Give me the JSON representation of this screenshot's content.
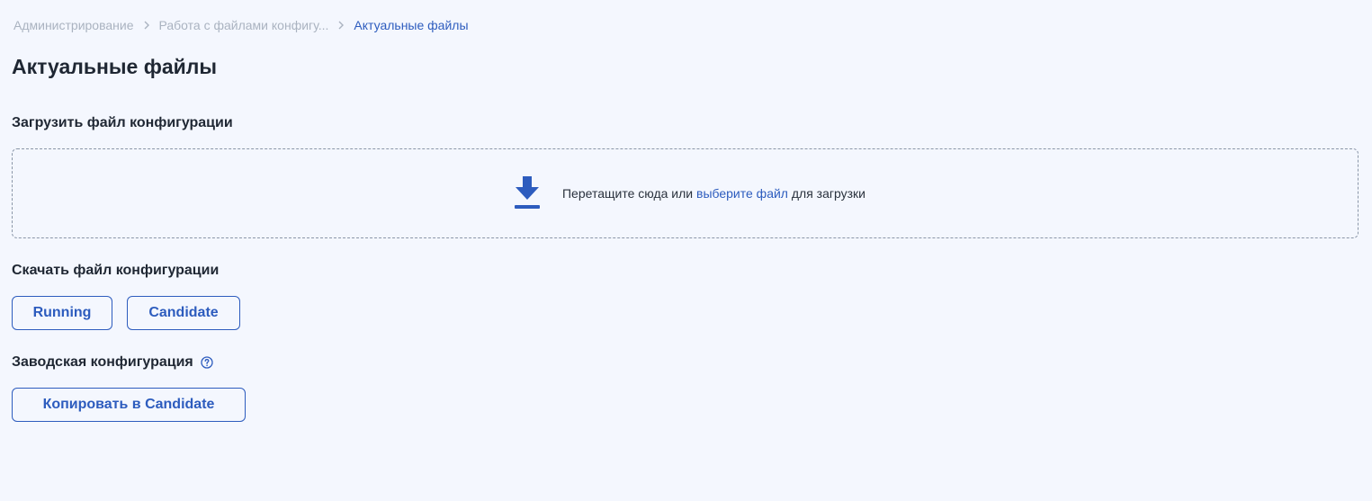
{
  "breadcrumb": {
    "items": [
      "Администрирование",
      "Работа с файлами конфигу...",
      "Актуальные файлы"
    ]
  },
  "page": {
    "title": "Актуальные файлы"
  },
  "upload": {
    "label": "Загрузить файл конфигурации",
    "text_before": "Перетащите сюда или ",
    "link_text": "выберите файл",
    "text_after": " для загрузки",
    "icon": "download-icon"
  },
  "download": {
    "label": "Скачать файл конфигурации",
    "running_button": "Running",
    "candidate_button": "Candidate"
  },
  "factory": {
    "label": "Заводская конфигурация",
    "help_icon": "question-circle-icon",
    "copy_button": "Копировать в Candidate"
  },
  "colors": {
    "background": "#f4f7fe",
    "accent": "#2d5cbe",
    "muted": "#aab3c0",
    "text": "#1f2733"
  }
}
